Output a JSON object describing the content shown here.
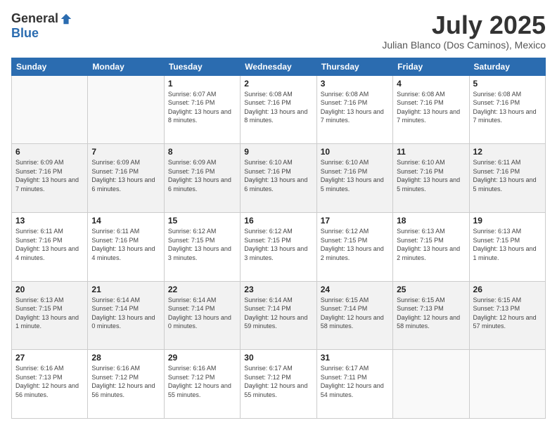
{
  "logo": {
    "general": "General",
    "blue": "Blue"
  },
  "header": {
    "month": "July 2025",
    "location": "Julian Blanco (Dos Caminos), Mexico"
  },
  "weekdays": [
    "Sunday",
    "Monday",
    "Tuesday",
    "Wednesday",
    "Thursday",
    "Friday",
    "Saturday"
  ],
  "weeks": [
    [
      {
        "day": "",
        "info": ""
      },
      {
        "day": "",
        "info": ""
      },
      {
        "day": "1",
        "info": "Sunrise: 6:07 AM\nSunset: 7:16 PM\nDaylight: 13 hours and 8 minutes."
      },
      {
        "day": "2",
        "info": "Sunrise: 6:08 AM\nSunset: 7:16 PM\nDaylight: 13 hours and 8 minutes."
      },
      {
        "day": "3",
        "info": "Sunrise: 6:08 AM\nSunset: 7:16 PM\nDaylight: 13 hours and 7 minutes."
      },
      {
        "day": "4",
        "info": "Sunrise: 6:08 AM\nSunset: 7:16 PM\nDaylight: 13 hours and 7 minutes."
      },
      {
        "day": "5",
        "info": "Sunrise: 6:08 AM\nSunset: 7:16 PM\nDaylight: 13 hours and 7 minutes."
      }
    ],
    [
      {
        "day": "6",
        "info": "Sunrise: 6:09 AM\nSunset: 7:16 PM\nDaylight: 13 hours and 7 minutes."
      },
      {
        "day": "7",
        "info": "Sunrise: 6:09 AM\nSunset: 7:16 PM\nDaylight: 13 hours and 6 minutes."
      },
      {
        "day": "8",
        "info": "Sunrise: 6:09 AM\nSunset: 7:16 PM\nDaylight: 13 hours and 6 minutes."
      },
      {
        "day": "9",
        "info": "Sunrise: 6:10 AM\nSunset: 7:16 PM\nDaylight: 13 hours and 6 minutes."
      },
      {
        "day": "10",
        "info": "Sunrise: 6:10 AM\nSunset: 7:16 PM\nDaylight: 13 hours and 5 minutes."
      },
      {
        "day": "11",
        "info": "Sunrise: 6:10 AM\nSunset: 7:16 PM\nDaylight: 13 hours and 5 minutes."
      },
      {
        "day": "12",
        "info": "Sunrise: 6:11 AM\nSunset: 7:16 PM\nDaylight: 13 hours and 5 minutes."
      }
    ],
    [
      {
        "day": "13",
        "info": "Sunrise: 6:11 AM\nSunset: 7:16 PM\nDaylight: 13 hours and 4 minutes."
      },
      {
        "day": "14",
        "info": "Sunrise: 6:11 AM\nSunset: 7:16 PM\nDaylight: 13 hours and 4 minutes."
      },
      {
        "day": "15",
        "info": "Sunrise: 6:12 AM\nSunset: 7:15 PM\nDaylight: 13 hours and 3 minutes."
      },
      {
        "day": "16",
        "info": "Sunrise: 6:12 AM\nSunset: 7:15 PM\nDaylight: 13 hours and 3 minutes."
      },
      {
        "day": "17",
        "info": "Sunrise: 6:12 AM\nSunset: 7:15 PM\nDaylight: 13 hours and 2 minutes."
      },
      {
        "day": "18",
        "info": "Sunrise: 6:13 AM\nSunset: 7:15 PM\nDaylight: 13 hours and 2 minutes."
      },
      {
        "day": "19",
        "info": "Sunrise: 6:13 AM\nSunset: 7:15 PM\nDaylight: 13 hours and 1 minute."
      }
    ],
    [
      {
        "day": "20",
        "info": "Sunrise: 6:13 AM\nSunset: 7:15 PM\nDaylight: 13 hours and 1 minute."
      },
      {
        "day": "21",
        "info": "Sunrise: 6:14 AM\nSunset: 7:14 PM\nDaylight: 13 hours and 0 minutes."
      },
      {
        "day": "22",
        "info": "Sunrise: 6:14 AM\nSunset: 7:14 PM\nDaylight: 13 hours and 0 minutes."
      },
      {
        "day": "23",
        "info": "Sunrise: 6:14 AM\nSunset: 7:14 PM\nDaylight: 12 hours and 59 minutes."
      },
      {
        "day": "24",
        "info": "Sunrise: 6:15 AM\nSunset: 7:14 PM\nDaylight: 12 hours and 58 minutes."
      },
      {
        "day": "25",
        "info": "Sunrise: 6:15 AM\nSunset: 7:13 PM\nDaylight: 12 hours and 58 minutes."
      },
      {
        "day": "26",
        "info": "Sunrise: 6:15 AM\nSunset: 7:13 PM\nDaylight: 12 hours and 57 minutes."
      }
    ],
    [
      {
        "day": "27",
        "info": "Sunrise: 6:16 AM\nSunset: 7:13 PM\nDaylight: 12 hours and 56 minutes."
      },
      {
        "day": "28",
        "info": "Sunrise: 6:16 AM\nSunset: 7:12 PM\nDaylight: 12 hours and 56 minutes."
      },
      {
        "day": "29",
        "info": "Sunrise: 6:16 AM\nSunset: 7:12 PM\nDaylight: 12 hours and 55 minutes."
      },
      {
        "day": "30",
        "info": "Sunrise: 6:17 AM\nSunset: 7:12 PM\nDaylight: 12 hours and 55 minutes."
      },
      {
        "day": "31",
        "info": "Sunrise: 6:17 AM\nSunset: 7:11 PM\nDaylight: 12 hours and 54 minutes."
      },
      {
        "day": "",
        "info": ""
      },
      {
        "day": "",
        "info": ""
      }
    ]
  ]
}
